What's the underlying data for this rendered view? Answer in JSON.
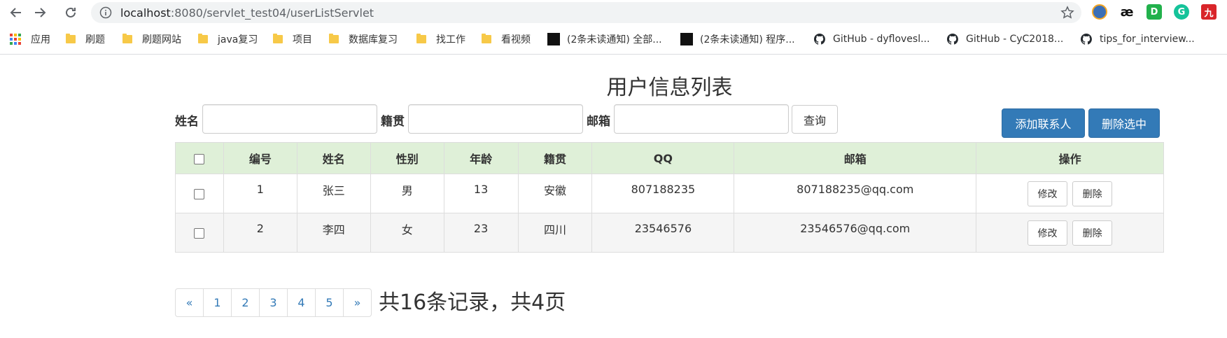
{
  "browser": {
    "url_host": "localhost",
    "url_path": ":8080/servlet_test04/userListServlet",
    "bookmarks": [
      {
        "label": "应用",
        "icon": "apps-grid-icon"
      },
      {
        "label": "刷题",
        "icon": "folder-icon"
      },
      {
        "label": "刷题网站",
        "icon": "folder-icon"
      },
      {
        "label": "java复习",
        "icon": "folder-icon"
      },
      {
        "label": "项目",
        "icon": "folder-icon"
      },
      {
        "label": "数据库复习",
        "icon": "folder-icon"
      },
      {
        "label": "找工作",
        "icon": "folder-icon"
      },
      {
        "label": "看视频",
        "icon": "folder-icon"
      },
      {
        "label": "(2条未读通知) 全部...",
        "icon": "csdn-icon"
      },
      {
        "label": "(2条未读通知) 程序...",
        "icon": "csdn-icon"
      },
      {
        "label": "GitHub - dyflovesl...",
        "icon": "github-icon"
      },
      {
        "label": "GitHub - CyC2018...",
        "icon": "github-icon"
      },
      {
        "label": "tips_for_interview...",
        "icon": "github-icon"
      }
    ],
    "extensions": [
      {
        "name": "extension-avatar-icon",
        "glyph": "",
        "color": "#3b6fb6"
      },
      {
        "name": "extension-ae-icon",
        "glyph": "æ",
        "color": "#ffffff"
      },
      {
        "name": "extension-d-icon",
        "glyph": "D",
        "color": "#22b14c"
      },
      {
        "name": "extension-grammarly-icon",
        "glyph": "G",
        "color": "#15c39a"
      },
      {
        "name": "extension-red-icon",
        "glyph": "九",
        "color": "#d9252a"
      }
    ]
  },
  "page": {
    "title": "用户信息列表",
    "search": {
      "name_label": "姓名",
      "name_value": "",
      "origin_label": "籍贯",
      "origin_value": "",
      "email_label": "邮箱",
      "email_value": "",
      "query_button": "查询"
    },
    "actions": {
      "add_button": "添加联系人",
      "delete_selected_button": "删除选中"
    },
    "table": {
      "headers": [
        "编号",
        "姓名",
        "性别",
        "年龄",
        "籍贯",
        "QQ",
        "邮箱",
        "操作"
      ],
      "rows": [
        {
          "id": "1",
          "name": "张三",
          "gender": "男",
          "age": "13",
          "origin": "安徽",
          "qq": "807188235",
          "email": "807188235@qq.com"
        },
        {
          "id": "2",
          "name": "李四",
          "gender": "女",
          "age": "23",
          "origin": "四川",
          "qq": "23546576",
          "email": "23546576@qq.com"
        }
      ],
      "edit_label": "修改",
      "delete_label": "删除"
    },
    "pagination": {
      "prev": "«",
      "pages": [
        "1",
        "2",
        "3",
        "4",
        "5"
      ],
      "next": "»",
      "summary": "共16条记录，共4页"
    }
  },
  "colors": {
    "primary": "#337ab7",
    "header_bg": "#dff0d8",
    "striped_row": "#f5f5f5"
  }
}
